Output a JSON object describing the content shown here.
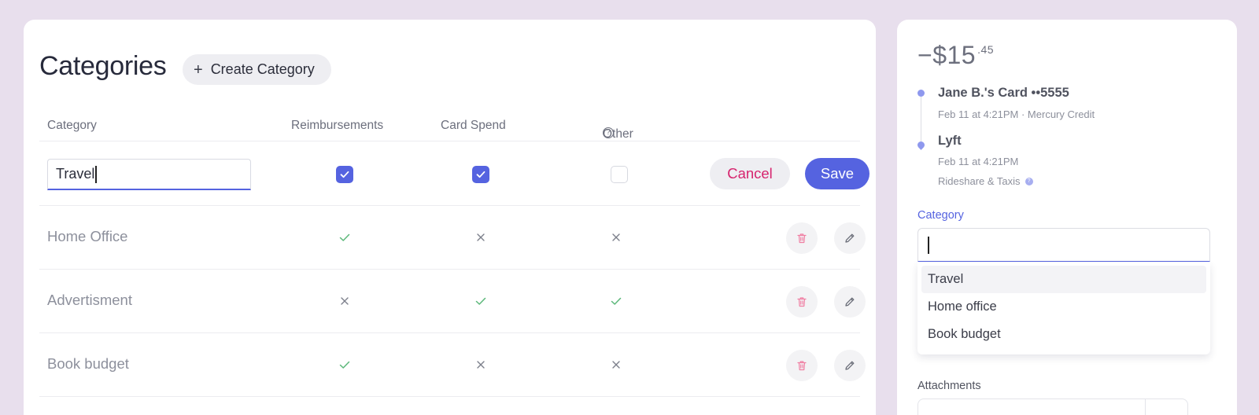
{
  "categories_panel": {
    "title": "Categories",
    "create_button_label": "Create Category",
    "columns": {
      "category": "Category",
      "reimbursements": "Reimbursements",
      "card_spend": "Card Spend",
      "other": "Other"
    },
    "editing_row": {
      "name_value": "Travel",
      "reimbursements": true,
      "card_spend": true,
      "other": false,
      "cancel_label": "Cancel",
      "save_label": "Save"
    },
    "rows": [
      {
        "name": "Home Office",
        "reimbursements": true,
        "card_spend": false,
        "other": false
      },
      {
        "name": "Advertisment",
        "reimbursements": false,
        "card_spend": true,
        "other": true
      },
      {
        "name": "Book budget",
        "reimbursements": true,
        "card_spend": false,
        "other": false
      }
    ]
  },
  "transaction_panel": {
    "amount_main": "−$15",
    "amount_cents": ".45",
    "timeline": [
      {
        "title": "Jane B.'s Card ••5555",
        "subtitle": "Feb 11 at 4:21PM · Mercury Credit"
      },
      {
        "title": "Lyft",
        "subtitle": "Feb 11 at 4:21PM",
        "category": "Rideshare & Taxis"
      }
    ],
    "category_label": "Category",
    "category_input_value": "",
    "category_options": [
      "Travel",
      "Home office",
      "Book budget"
    ],
    "attachments_label": "Attachments"
  },
  "colors": {
    "accent": "#5563e0",
    "danger": "#d6246e",
    "success": "#5cb87a",
    "background": "#e8dfed"
  }
}
